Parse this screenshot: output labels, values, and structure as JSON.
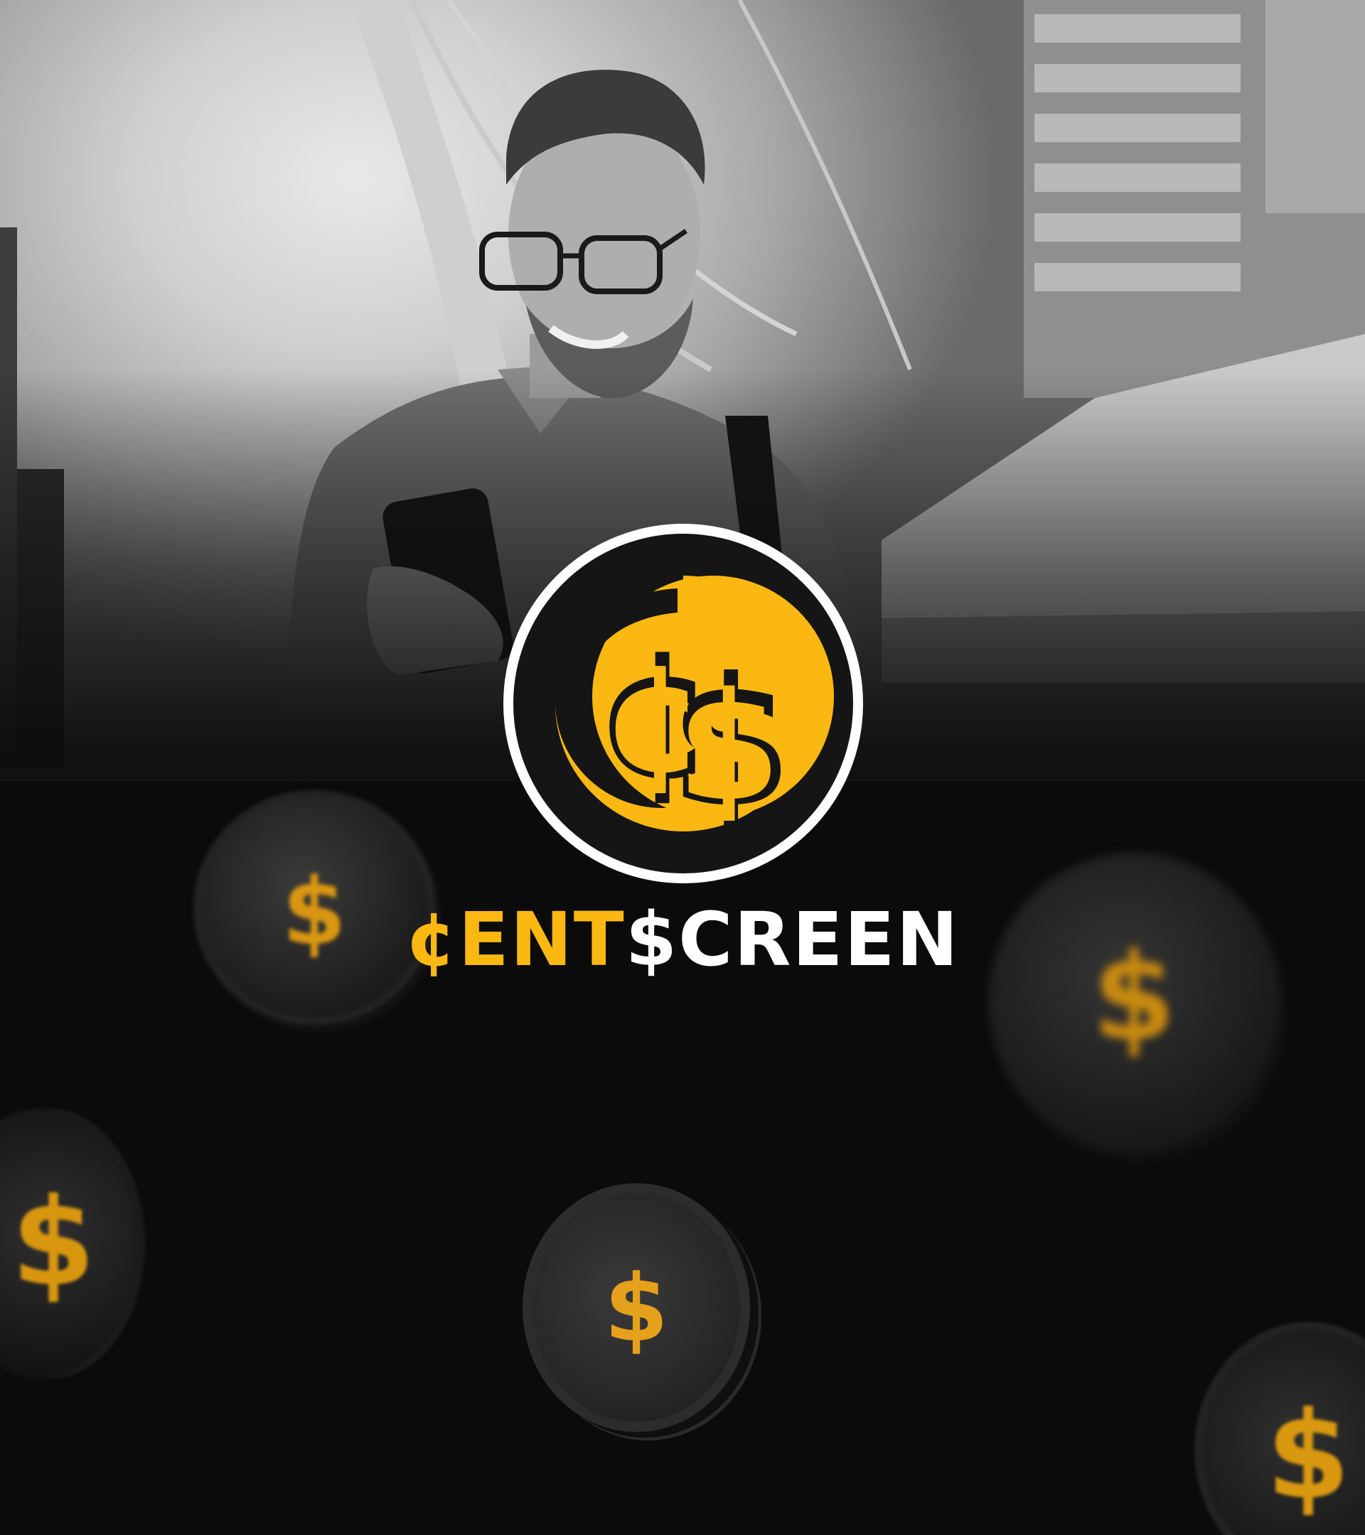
{
  "brand": {
    "part1": "¢ENT",
    "part2": "$CREEN"
  },
  "colors": {
    "accent": "#fbb813",
    "background": "#0b0b0b",
    "coin_face": "#2a2a2a",
    "coin_symbol": "#e8a414",
    "logo_ring": "#ffffff"
  },
  "icons": {
    "logo": "cent-dollar-logo-icon",
    "coin": "dollar-coin-icon"
  },
  "coins": [
    {
      "label": "$"
    },
    {
      "label": "$"
    },
    {
      "label": "$"
    },
    {
      "label": "$"
    },
    {
      "label": "$"
    }
  ]
}
